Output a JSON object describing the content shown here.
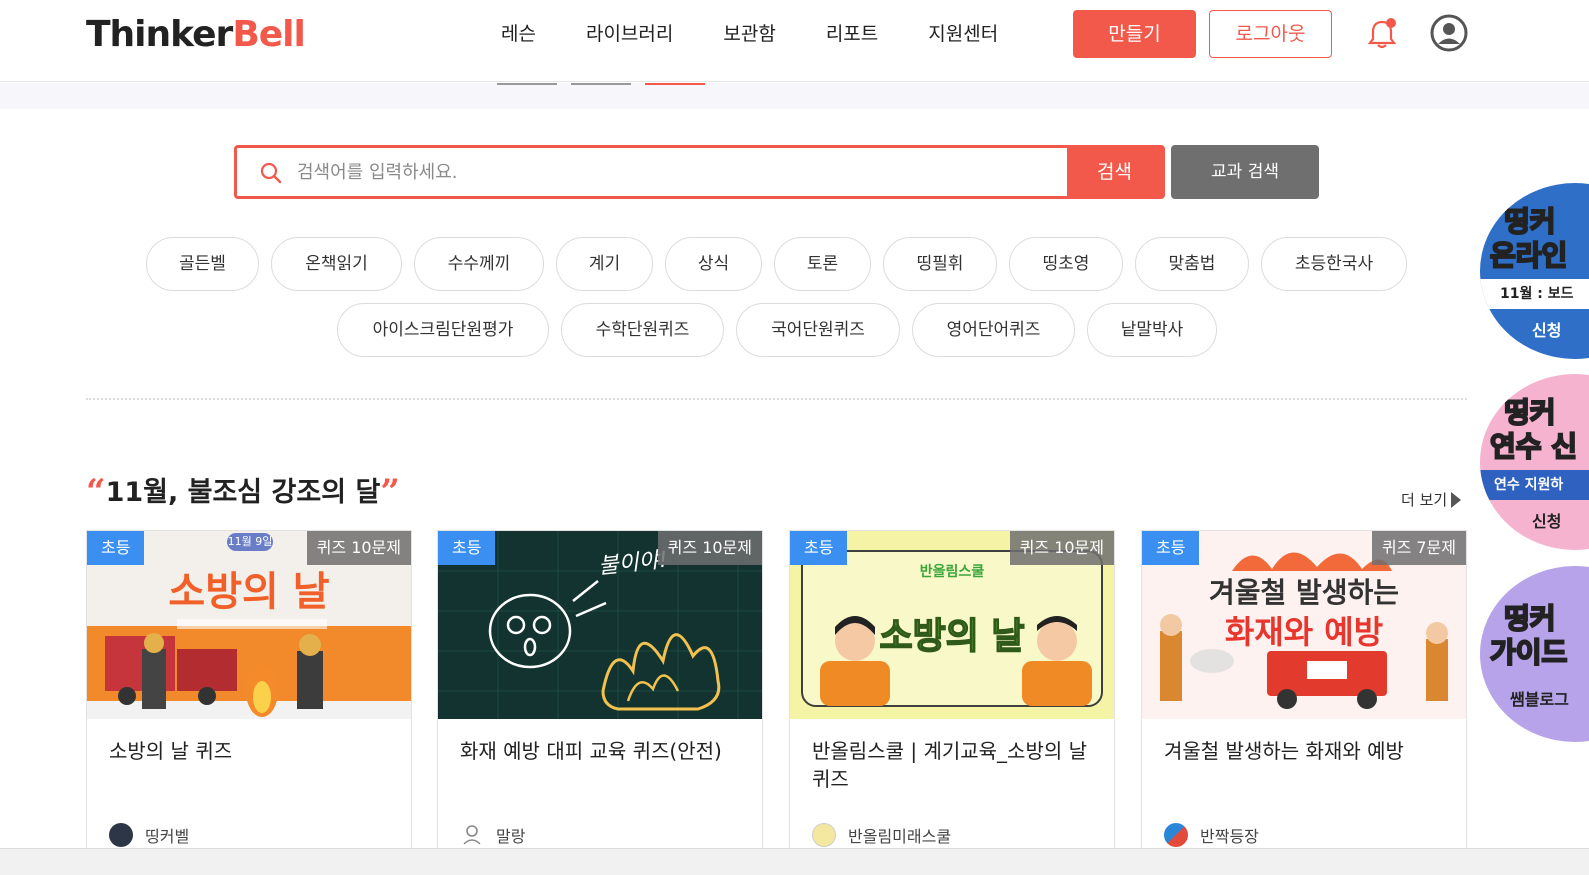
{
  "header": {
    "logo_part1": "Thinker",
    "logo_part2": "Bell",
    "nav": [
      "레슨",
      "라이브러리",
      "보관함",
      "리포트",
      "지원센터"
    ],
    "make_label": "만들기",
    "logout_label": "로그아웃"
  },
  "search": {
    "placeholder": "검색어를 입력하세요.",
    "button_label": "검색",
    "subject_search_label": "교과 검색"
  },
  "tags": {
    "row1": [
      "골든벨",
      "온책읽기",
      "수수께끼",
      "계기",
      "상식",
      "토론",
      "띵필휘",
      "띵초영",
      "맞춤법",
      "초등한국사"
    ],
    "row2": [
      "아이스크림단원평가",
      "수학단원퀴즈",
      "국어단원퀴즈",
      "영어단어퀴즈",
      "낱말박사"
    ]
  },
  "section": {
    "quote_open": "“",
    "title": "11월, 불조심 강조의 달",
    "quote_close": "”",
    "more_label": "더 보기"
  },
  "cards": [
    {
      "level": "초등",
      "count": "퀴즈 10문제",
      "title": "소방의 날 퀴즈",
      "author": "띵커벨",
      "thumb_text": "소방의 날",
      "thumb_sub": "11월 9일"
    },
    {
      "level": "초등",
      "count": "퀴즈 10문제",
      "title": "화재 예방 대피 교육 퀴즈(안전)",
      "author": "말랑",
      "thumb_text": "불이야!"
    },
    {
      "level": "초등",
      "count": "퀴즈 10문제",
      "title": "반올림스쿨 | 계기교육_소방의 날 퀴즈",
      "author": "반올림미래스쿨",
      "thumb_text": "소방의 날",
      "thumb_sub": "반올림스쿨"
    },
    {
      "level": "초등",
      "count": "퀴즈 7문제",
      "title": "겨울철 발생하는 화재와 예방",
      "author": "반짝등장",
      "thumb_text": "겨울철 발생하는",
      "thumb_text2": "화재와 예방"
    }
  ],
  "promos": [
    {
      "title1": "띵커",
      "title2": "온라인",
      "band": "11월 : 보드",
      "foot": "신청"
    },
    {
      "title1": "띵커",
      "title2": "연수 신",
      "band": "연수 지원하",
      "foot": "신청"
    },
    {
      "title1": "띵커",
      "title2": "가이드",
      "foot": "쌤블로그"
    }
  ],
  "colors": {
    "accent": "#f2594b",
    "level_badge": "#3b8ff0",
    "subject_btn": "#6f6f6f"
  }
}
